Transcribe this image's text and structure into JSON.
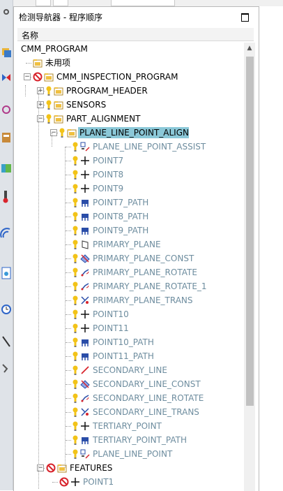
{
  "panel": {
    "title": "检测导航器 - 程序顺序",
    "column_header": "名称"
  },
  "tree": {
    "rows": [
      {
        "label": "CMM_PROGRAM",
        "level": 0,
        "toggle": "none",
        "icons": [],
        "gray": false,
        "selected": false
      },
      {
        "label": "未用项",
        "level": 1,
        "toggle": "none",
        "icons": [
          "folder"
        ],
        "gray": false,
        "selected": false
      },
      {
        "label": "CMM_INSPECTION_PROGRAM",
        "level": 1,
        "toggle": "minus",
        "icons": [
          "no",
          "folder"
        ],
        "gray": false,
        "selected": false
      },
      {
        "label": "PROGRAM_HEADER",
        "level": 2,
        "toggle": "plus",
        "icons": [
          "bulb",
          "folder"
        ],
        "gray": false,
        "selected": false
      },
      {
        "label": "SENSORS",
        "level": 2,
        "toggle": "plus",
        "icons": [
          "bulb",
          "folder"
        ],
        "gray": false,
        "selected": false
      },
      {
        "label": "PART_ALIGNMENT",
        "level": 2,
        "toggle": "minus",
        "icons": [
          "bulb",
          "folder"
        ],
        "gray": false,
        "selected": false
      },
      {
        "label": "PLANE_LINE_POINT_ALIGN",
        "level": 3,
        "toggle": "minus",
        "icons": [
          "bulb",
          "folder"
        ],
        "gray": false,
        "selected": true
      },
      {
        "label": "PLANE_LINE_POINT_ASSIST",
        "level": 4,
        "toggle": "none",
        "icons": [
          "bulb",
          "assist"
        ],
        "gray": true,
        "selected": false
      },
      {
        "label": "POINT7",
        "level": 4,
        "toggle": "none",
        "icons": [
          "bulb",
          "point"
        ],
        "gray": true,
        "selected": false
      },
      {
        "label": "POINT8",
        "level": 4,
        "toggle": "none",
        "icons": [
          "bulb",
          "point"
        ],
        "gray": true,
        "selected": false
      },
      {
        "label": "POINT9",
        "level": 4,
        "toggle": "none",
        "icons": [
          "bulb",
          "point"
        ],
        "gray": true,
        "selected": false
      },
      {
        "label": "POINT7_PATH",
        "level": 4,
        "toggle": "none",
        "icons": [
          "bulb",
          "path"
        ],
        "gray": true,
        "selected": false
      },
      {
        "label": "POINT8_PATH",
        "level": 4,
        "toggle": "none",
        "icons": [
          "bulb",
          "path"
        ],
        "gray": true,
        "selected": false
      },
      {
        "label": "POINT9_PATH",
        "level": 4,
        "toggle": "none",
        "icons": [
          "bulb",
          "path"
        ],
        "gray": true,
        "selected": false
      },
      {
        "label": "PRIMARY_PLANE",
        "level": 4,
        "toggle": "none",
        "icons": [
          "bulb",
          "plane"
        ],
        "gray": true,
        "selected": false
      },
      {
        "label": "PRIMARY_PLANE_CONST",
        "level": 4,
        "toggle": "none",
        "icons": [
          "bulb",
          "const"
        ],
        "gray": true,
        "selected": false
      },
      {
        "label": "PRIMARY_PLANE_ROTATE",
        "level": 4,
        "toggle": "none",
        "icons": [
          "bulb",
          "rotate"
        ],
        "gray": true,
        "selected": false
      },
      {
        "label": "PRIMARY_PLANE_ROTATE_1",
        "level": 4,
        "toggle": "none",
        "icons": [
          "bulb",
          "rotate"
        ],
        "gray": true,
        "selected": false
      },
      {
        "label": "PRIMARY_PLANE_TRANS",
        "level": 4,
        "toggle": "none",
        "icons": [
          "bulb",
          "trans"
        ],
        "gray": true,
        "selected": false
      },
      {
        "label": "POINT10",
        "level": 4,
        "toggle": "none",
        "icons": [
          "bulb",
          "point"
        ],
        "gray": true,
        "selected": false
      },
      {
        "label": "POINT11",
        "level": 4,
        "toggle": "none",
        "icons": [
          "bulb",
          "point"
        ],
        "gray": true,
        "selected": false
      },
      {
        "label": "POINT10_PATH",
        "level": 4,
        "toggle": "none",
        "icons": [
          "bulb",
          "path"
        ],
        "gray": true,
        "selected": false
      },
      {
        "label": "POINT11_PATH",
        "level": 4,
        "toggle": "none",
        "icons": [
          "bulb",
          "path"
        ],
        "gray": true,
        "selected": false
      },
      {
        "label": "SECONDARY_LINE",
        "level": 4,
        "toggle": "none",
        "icons": [
          "bulb",
          "line"
        ],
        "gray": true,
        "selected": false
      },
      {
        "label": "SECONDARY_LINE_CONST",
        "level": 4,
        "toggle": "none",
        "icons": [
          "bulb",
          "const"
        ],
        "gray": true,
        "selected": false
      },
      {
        "label": "SECONDARY_LINE_ROTATE",
        "level": 4,
        "toggle": "none",
        "icons": [
          "bulb",
          "rotate"
        ],
        "gray": true,
        "selected": false
      },
      {
        "label": "SECONDARY_LINE_TRANS",
        "level": 4,
        "toggle": "none",
        "icons": [
          "bulb",
          "trans"
        ],
        "gray": true,
        "selected": false
      },
      {
        "label": "TERTIARY_POINT",
        "level": 4,
        "toggle": "none",
        "icons": [
          "bulb",
          "point"
        ],
        "gray": true,
        "selected": false
      },
      {
        "label": "TERTIARY_POINT_PATH",
        "level": 4,
        "toggle": "none",
        "icons": [
          "bulb",
          "path"
        ],
        "gray": true,
        "selected": false
      },
      {
        "label": "PLANE_LINE_POINT",
        "level": 4,
        "toggle": "none",
        "icons": [
          "bulb",
          "assist"
        ],
        "gray": true,
        "selected": false
      },
      {
        "label": "FEATURES",
        "level": 2,
        "toggle": "minus",
        "icons": [
          "no",
          "folder"
        ],
        "gray": false,
        "selected": false
      },
      {
        "label": "POINT1",
        "level": 3,
        "toggle": "none",
        "icons": [
          "no",
          "point"
        ],
        "gray": true,
        "selected": false
      }
    ]
  },
  "colors": {
    "selected_bg": "#8bc8d8",
    "gray_text": "#6e8d9f",
    "bulb": "#f2c318",
    "folder": "#f0c040",
    "no_sign": "#d8242c",
    "path_icon": "#2a4da8"
  }
}
